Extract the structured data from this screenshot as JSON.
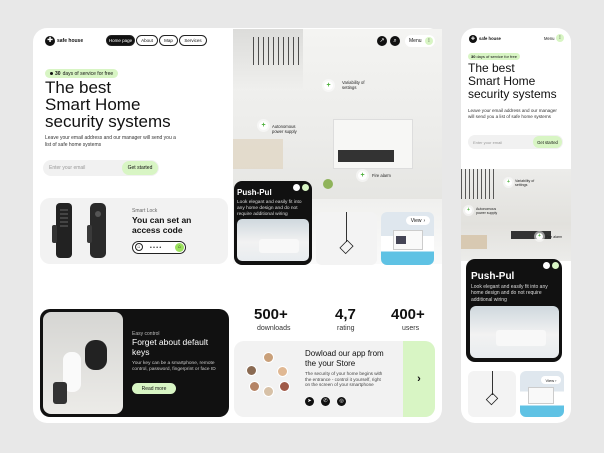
{
  "brand": {
    "logo_text": "safe house"
  },
  "nav": {
    "items": [
      "Home page",
      "About",
      "Map",
      "Services"
    ],
    "menu": "Menu"
  },
  "hero": {
    "badge_strong": "30",
    "badge_text": "days of service for free",
    "title_line1": "The best",
    "title_line2": "Smart Home",
    "title_line3": "security systems",
    "desc": "Leave your email address and our manager will send you a list of safe home systems",
    "email_placeholder": "Enter your email",
    "cta": "Get started"
  },
  "lock": {
    "tag": "Smart Lock",
    "title": "You can set an access code",
    "dots": "• • • •"
  },
  "hotspots": {
    "variability": "Variability of settings",
    "autonomous": "Autonomous power supply",
    "fire": "Fire alarm"
  },
  "pushpul": {
    "title": "Push-Pul",
    "desc": "Look elegant and easily fit into any home design and do not require additional wiring"
  },
  "view": {
    "label": "View"
  },
  "keys": {
    "tag": "Easy control",
    "title": "Forget about default keys",
    "desc": "Your key can be a smartphone, remote control, password, fingerprint or face ID",
    "cta": "Read more"
  },
  "stats": [
    {
      "value": "500+",
      "label": "downloads"
    },
    {
      "value": "4,7",
      "label": "rating"
    },
    {
      "value": "400+",
      "label": "users"
    }
  ],
  "app": {
    "title": "Dowload our app from the your Store",
    "desc": "The security of your home begins with the entrance - control it yourself, right on the screen of your smartphone"
  },
  "mobile": {
    "title_line1": "The best",
    "title_line2": "Smart Home",
    "title_line3": "security systems",
    "desc": "Leave your email address and our manager will send you a list of safe home systems",
    "pushpul_title": "Push-Pul",
    "pushpul_desc": "Look elegant and easily fit into any home design and do not require additional wiring"
  },
  "colors": {
    "accent": "#9be15d",
    "accent_soft": "#d8f5c4",
    "dark": "#111111",
    "bg": "#e8e8e8"
  }
}
